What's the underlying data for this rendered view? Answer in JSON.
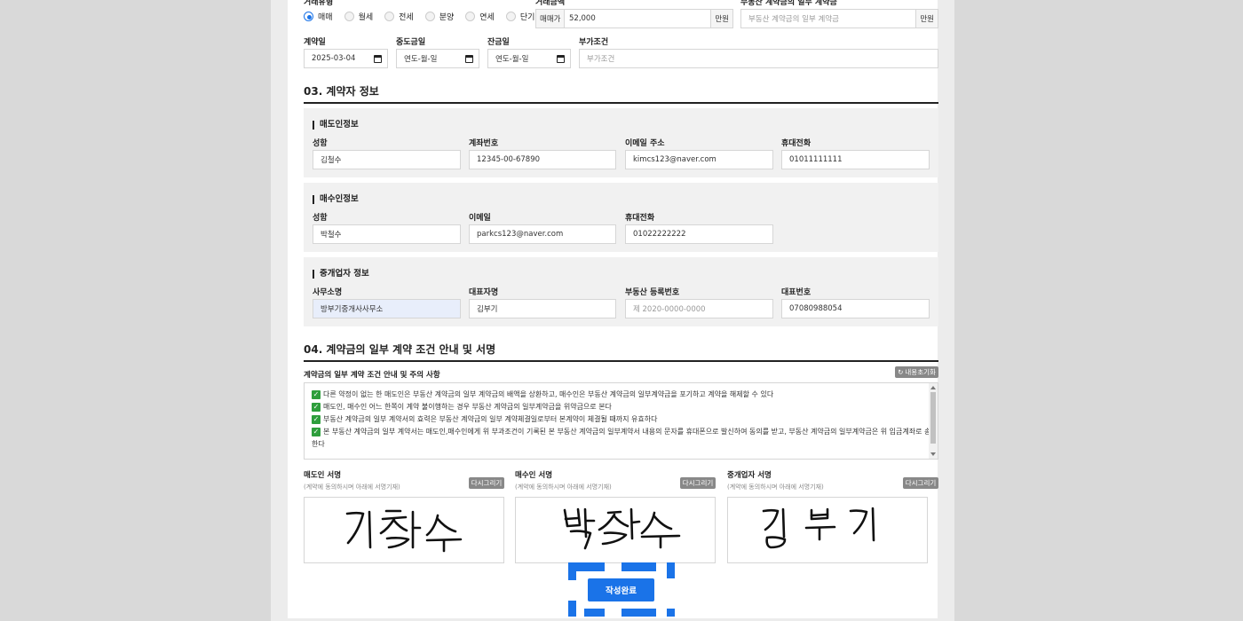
{
  "deal_type": {
    "label": "거래유형",
    "options": [
      "매매",
      "월세",
      "전세",
      "분양",
      "연세",
      "단기"
    ],
    "selected_index": 0
  },
  "trade_price": {
    "label": "거래금액",
    "prefix": "매매가",
    "value": "52,000",
    "unit": "만원"
  },
  "partial_payment": {
    "label": "부동산 계약금의 일부 계약금",
    "placeholder": "부동산 계약금의 일부 계약금",
    "unit": "만원"
  },
  "dates": {
    "contract_label": "계약일",
    "contract_value": "2025-03-04",
    "middle_label": "중도금일",
    "middle_value": "연도-월-일",
    "balance_label": "잔금일",
    "balance_value": "연도-월-일",
    "extra_label": "부가조건",
    "extra_placeholder": "부가조건"
  },
  "section3": {
    "title": "03. 계약자 정보",
    "seller": {
      "title": "매도인정보",
      "name_label": "성함",
      "name_value": "김철수",
      "account_label": "계좌번호",
      "account_value": "12345-00-67890",
      "email_label": "이메일 주소",
      "email_value": "kimcs123@naver.com",
      "phone_label": "휴대전화",
      "phone_value": "01011111111"
    },
    "buyer": {
      "title": "매수인정보",
      "name_label": "성함",
      "name_value": "박철수",
      "email_label": "이메일",
      "email_value": "parkcs123@naver.com",
      "phone_label": "휴대전화",
      "phone_value": "01022222222"
    },
    "broker": {
      "title": "중개업자 정보",
      "office_label": "사무소명",
      "office_value": "방부기중개사사무소",
      "rep_label": "대표자명",
      "rep_value": "김부기",
      "reg_label": "부동산 등록번호",
      "reg_placeholder": "제 2020-0000-0000",
      "tel_label": "대표번호",
      "tel_value": "07080988054"
    }
  },
  "section4": {
    "title": "04. 계약금의 일부 계약 조건 안내 및 서명",
    "terms_title": "계약금의 일부 계약 조건 안내 및 주의 사항",
    "reset_label": "내용초기화",
    "terms": [
      "다른 약정이 없는 한 매도인은 부동산 계약금의 일부 계약금의 배액을 상환하고, 매수인은 부동산 계약금의 일부계약금을 포기하고 계약을 해제할 수 있다",
      "매도인, 매수인 어느 한쪽이 계약 불이행하는 경우 부동산 계약금의 일부계약금을 위약금으로 본다",
      "부동산 계약금의 일부 계약서의 효력은 부동산 계약금의 일부 계약체결일로부터 본계약이 체결될 때까지 유효하다",
      "본 부동산 계약금의 일부 계약서는 매도인,매수인에게 위 부과조건이 기록된 본 부동산 계약금의 일부계약서 내용의 문자를 휴대폰으로 발신하여 동의를 받고, 부동산 계약금의 일부계약금은 위 입금계좌로 송금",
      "한다"
    ],
    "signatures": [
      {
        "title": "매도인 서명",
        "sub": "(계약에 동의하시며 아래에 서명기재)",
        "redraw": "다시그리기"
      },
      {
        "title": "매수인 서명",
        "sub": "(계약에 동의하시며 아래에 서명기재)",
        "redraw": "다시그리기"
      },
      {
        "title": "중개업자 서명",
        "sub": "(계약에 동의하시며 아래에 서명기재)",
        "redraw": "다시그리기"
      }
    ]
  },
  "submit_label": "작성완료",
  "colors": {
    "accent": "#1a73e8",
    "check": "#2e9e3c"
  }
}
